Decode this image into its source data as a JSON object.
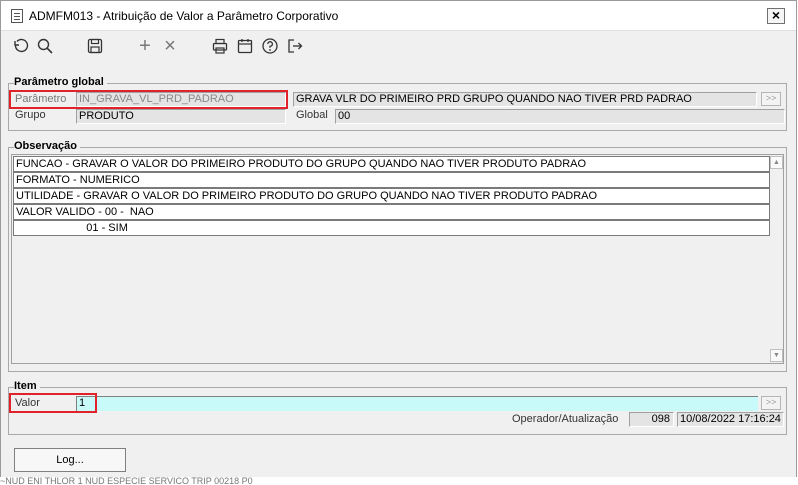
{
  "window": {
    "title": "ADMFM013 - Atribuição de Valor a Parâmetro Corporativo",
    "close_label": "×"
  },
  "toolbar": {
    "icons": [
      "undo-icon",
      "search-icon",
      "save-icon",
      "add-icon",
      "delete-icon",
      "print-icon",
      "calendar-icon",
      "help-icon",
      "exit-icon"
    ],
    "add_label": "+",
    "delete_label": "×"
  },
  "parametro_global": {
    "section_title": "Parâmetro global",
    "parametro_label": "Parâmetro",
    "parametro_value": "IN_GRAVA_VL_PRD_PADRAO",
    "descricao_value": "GRAVA VLR DO PRIMEIRO PRD GRUPO QUANDO NAO TIVER PRD PADRAO",
    "grupo_label": "Grupo",
    "grupo_value": "PRODUTO",
    "global_label": "Global",
    "global_value": "00",
    "lookup_label": ">>"
  },
  "observacao": {
    "section_title": "Observação",
    "lines": [
      "FUNCAO - GRAVAR O VALOR DO PRIMEIRO PRODUTO DO GRUPO QUANDO NAO TIVER PRODUTO PADRAO",
      "FORMATO - NUMERICO",
      "UTILIDADE - GRAVAR O VALOR DO PRIMEIRO PRODUTO DO GRUPO QUANDO NAO TIVER PRODUTO PADRAO",
      "VALOR VALIDO - 00 -  NAO",
      "                       01 - SIM"
    ],
    "scroll_up": "▲",
    "scroll_down": "▼"
  },
  "item": {
    "section_title": "Item",
    "valor_label": "Valor",
    "valor_value": "1",
    "lookup_label": ">>",
    "operador_label": "Operador/Atualização",
    "operador_value": "098",
    "atualizacao_value": "10/08/2022 17:16:24"
  },
  "footer": {
    "log_button": "Log..."
  },
  "background_strip": "~NUD  ENI THLOR                                         1 NUD  ESPECIE  SERVICO  TRIP                    00218 P0"
}
